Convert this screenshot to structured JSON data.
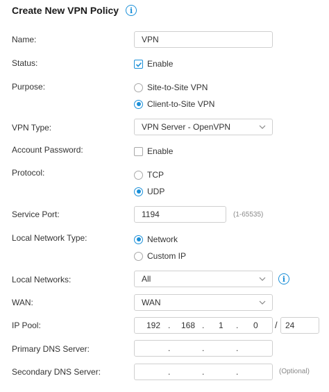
{
  "form": {
    "title": "Create New VPN Policy",
    "name": {
      "label": "Name:",
      "value": "VPN"
    },
    "status": {
      "label": "Status:",
      "option": "Enable",
      "checked": true
    },
    "purpose": {
      "label": "Purpose:",
      "options": [
        "Site-to-Site VPN",
        "Client-to-Site VPN"
      ],
      "selected": "Client-to-Site VPN"
    },
    "vpn_type": {
      "label": "VPN Type:",
      "value": "VPN Server - OpenVPN"
    },
    "account_password": {
      "label": "Account Password:",
      "option": "Enable",
      "checked": false
    },
    "protocol": {
      "label": "Protocol:",
      "options": [
        "TCP",
        "UDP"
      ],
      "selected": "UDP"
    },
    "service_port": {
      "label": "Service Port:",
      "value": "1194",
      "hint": "(1-65535)"
    },
    "local_network_type": {
      "label": "Local Network Type:",
      "options": [
        "Network",
        "Custom IP"
      ],
      "selected": "Network"
    },
    "local_networks": {
      "label": "Local Networks:",
      "value": "All"
    },
    "wan": {
      "label": "WAN:",
      "value": "WAN"
    },
    "ip_pool": {
      "label": "IP Pool:",
      "octets": [
        "192",
        "168",
        "1",
        "0"
      ],
      "separator": "/",
      "mask": "24"
    },
    "primary_dns": {
      "label": "Primary DNS Server:",
      "dots": [
        ".",
        ".",
        "."
      ]
    },
    "secondary_dns": {
      "label": "Secondary DNS Server:",
      "dots": [
        ".",
        ".",
        "."
      ],
      "hint": "(Optional)"
    }
  },
  "colors": {
    "accent": "#1a8fd8",
    "border": "#cfcfcf",
    "text": "#333333"
  },
  "icons": {
    "info": "info-icon",
    "chevron": "chevron-down-icon",
    "check": "checkmark-icon"
  }
}
